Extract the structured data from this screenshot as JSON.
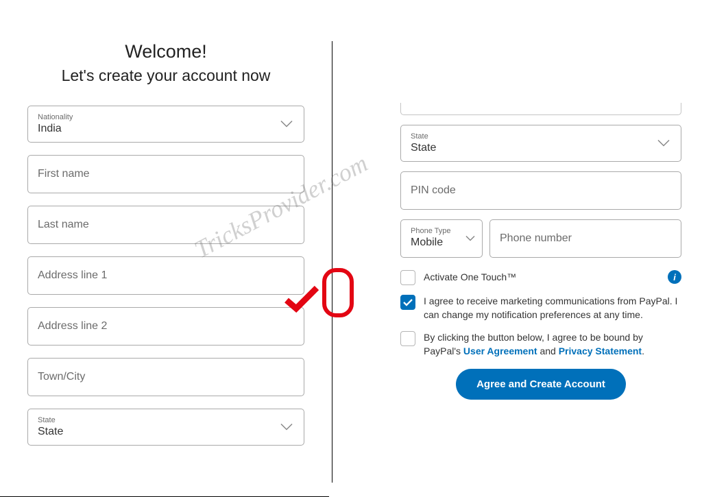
{
  "left": {
    "heading1": "Welcome!",
    "heading2": "Let's create your account now",
    "nationality_label": "Nationality",
    "nationality_value": "India",
    "first_name_ph": "First name",
    "last_name_ph": "Last name",
    "address1_ph": "Address line 1",
    "address2_ph": "Address line 2",
    "town_ph": "Town/City",
    "state_label": "State",
    "state_value": "State"
  },
  "right": {
    "state_label": "State",
    "state_value": "State",
    "pin_ph": "PIN code",
    "phone_type_label": "Phone Type",
    "phone_type_value": "Mobile",
    "phone_number_ph": "Phone number",
    "onetouch_label": "Activate One Touch™",
    "marketing_label": "I agree to receive marketing communications from PayPal. I can change my notification preferences at any time.",
    "terms_prefix": "By clicking the button below, I agree to be bound by PayPal's ",
    "terms_link1": "User Agreement",
    "terms_and": " and ",
    "terms_link2": "Privacy Statement",
    "terms_suffix": ".",
    "submit_label": "Agree and Create Account",
    "info_icon": "i"
  },
  "watermark": "TricksProvider.com"
}
